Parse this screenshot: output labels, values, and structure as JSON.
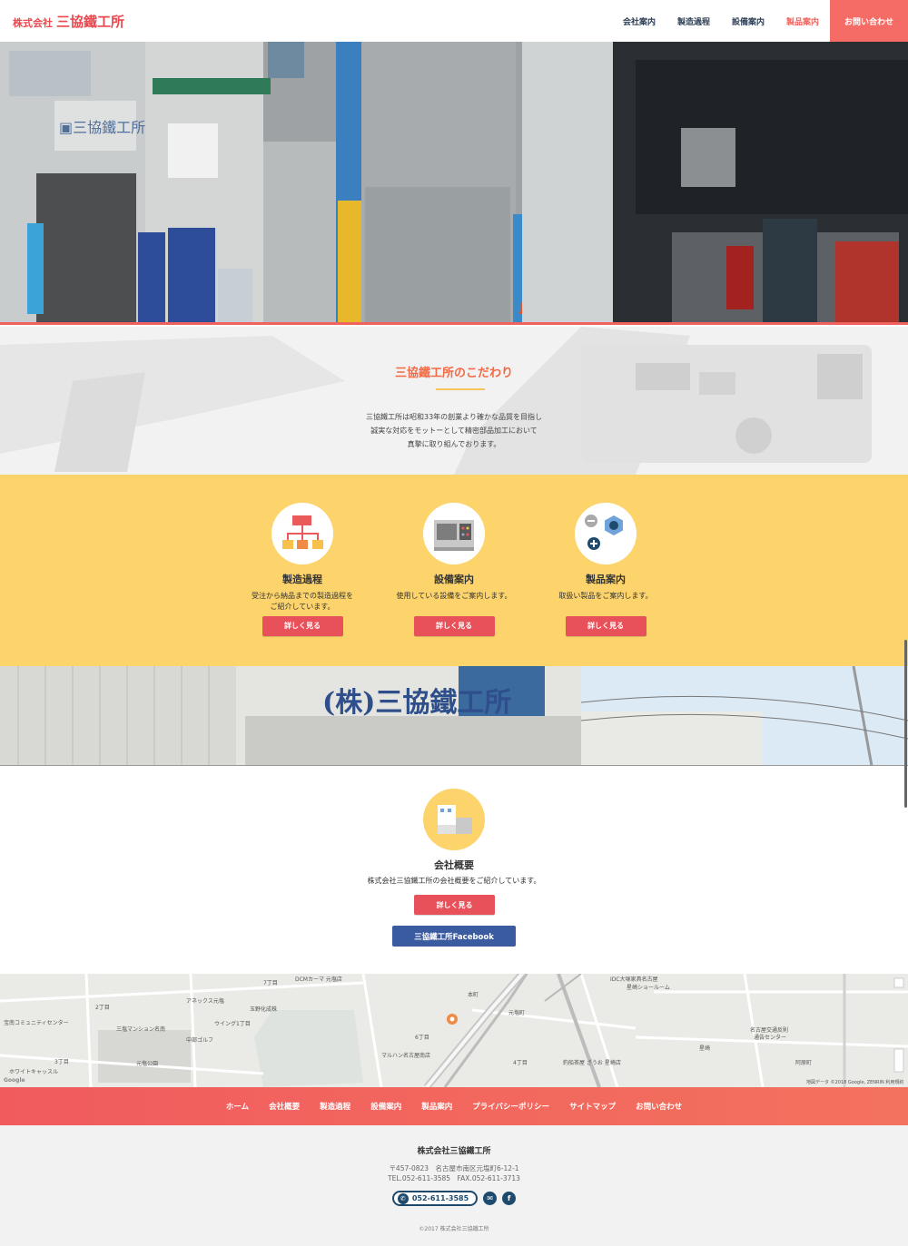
{
  "header": {
    "logo_small": "株式会社",
    "logo_big": "三協鐵工所",
    "nav": [
      "会社案内",
      "製造過程",
      "設備案内",
      "製品案内"
    ],
    "contact": "お問い合わせ"
  },
  "kodawari": {
    "title": "三協鐵工所のこだわり",
    "line1": "三協鐵工所は昭和33年の創業より確かな品質を目指し",
    "line2": "誠実な対応をモットーとして精密部品加工において",
    "line3": "真摯に取り組んでおります。"
  },
  "services": [
    {
      "name": "製造過程",
      "desc1": "受注から納品までの製造過程を",
      "desc2": "ご紹介しています。",
      "button": "詳しく見る",
      "icon": "flowchart-icon"
    },
    {
      "name": "設備案内",
      "desc1": "使用している設備をご案内します。",
      "desc2": "",
      "button": "詳しく見る",
      "icon": "machine-icon"
    },
    {
      "name": "製品案内",
      "desc1": "取扱い製品をご案内します。",
      "desc2": "",
      "button": "詳しく見る",
      "icon": "nut-icon"
    }
  ],
  "company": {
    "name": "会社概要",
    "desc": "株式会社三協鐵工所の会社概要をご紹介しています。",
    "button": "詳しく見る",
    "facebook": "三協鐵工所Facebook",
    "icon": "building-icon"
  },
  "map": {
    "labels": [
      "DCMカーマ 元塩店",
      "アネックス元塩",
      "玉野化成株",
      "ウイング1丁目",
      "元塩公園",
      "マルハン名古屋南店",
      "元塩町",
      "三塩マンション名南",
      "星崎",
      "阿原町",
      "IDC大塚家具名古屋",
      "星崎ショールーム",
      "名古屋交通反則",
      "通告センター",
      "釣船茶屋 ざうお 星崎店",
      "ホワイトキャッスル",
      "宝南コミュニティセンター",
      "中部ゴルフ",
      "2丁目",
      "3丁目",
      "6丁目",
      "7丁目",
      "4丁目",
      "本町"
    ],
    "google": "Google",
    "attribution": "地図データ ©2018 Google, ZENRIN   利用規約"
  },
  "footer_nav": [
    "ホーム",
    "会社概要",
    "製造過程",
    "設備案内",
    "製品案内",
    "プライバシーポリシー",
    "サイトマップ",
    "お問い合わせ"
  ],
  "footer": {
    "company": "株式会社三協鐵工所",
    "address": "〒457-0823　名古屋市南区元塩町6-12-1",
    "telfax": "TEL.052-611-3585　FAX.052-611-3713",
    "tel_button": "052-611-3585",
    "copyright": "©2017 株式会社三協鐵工所"
  },
  "colors": {
    "accent": "#f56b66",
    "yellow": "#fdd46c",
    "navy": "#1e4a6d",
    "facebook": "#3b5ba0"
  }
}
